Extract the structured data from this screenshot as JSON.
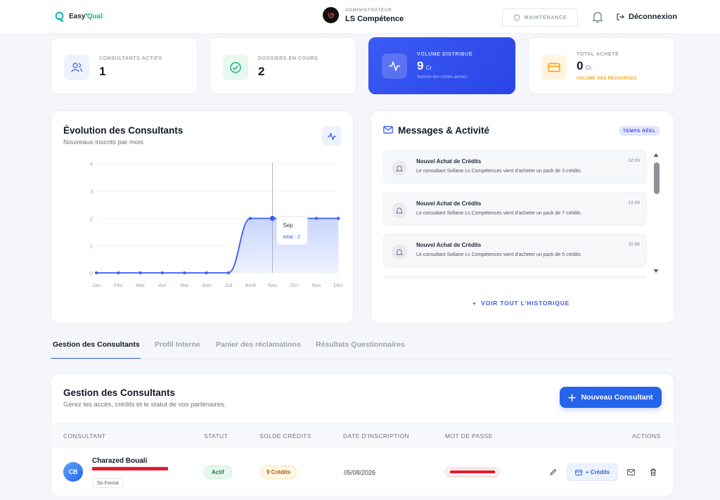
{
  "header": {
    "brand_prefix": "Easy",
    "brand_suffix": "Qual",
    "admin_role": "ADMINISTRATEUR",
    "admin_name": "LS Compétence",
    "maintenance_label": "MAINTENANCE",
    "logout_label": "Déconnexion"
  },
  "stats": [
    {
      "label": "CONSULTANTS ACTIFS",
      "value": "1",
      "unit": "",
      "sub": ""
    },
    {
      "label": "DOSSIERS EN COURS",
      "value": "2",
      "unit": "",
      "sub": ""
    },
    {
      "label": "VOLUME DISTRIBUÉ",
      "value": "9",
      "unit": "Cr.",
      "sub": "Somme des soldes actuels"
    },
    {
      "label": "TOTAL ACHETÉ",
      "value": "0",
      "unit": "Cr.",
      "sub": "VOLUME DES RECHARGES"
    }
  ],
  "chart_panel": {
    "title": "Évolution des Consultants",
    "subtitle": "Nouveaux inscrits par mois",
    "tooltip_label": "Sep",
    "tooltip_value": "total : 2"
  },
  "chart_data": {
    "type": "area",
    "categories": [
      "Jan",
      "Fév",
      "Mar",
      "Avr",
      "Mai",
      "Juin",
      "Juil",
      "Août",
      "Sep",
      "Oct",
      "Nov",
      "Déc"
    ],
    "series": [
      {
        "name": "total",
        "values": [
          0,
          0,
          0,
          0,
          0,
          0,
          0,
          2,
          2,
          2,
          2,
          2
        ]
      }
    ],
    "ylim": [
      0,
      4
    ],
    "yticks": [
      0,
      1,
      2,
      3,
      4
    ],
    "grid": true,
    "highlight_index": 8,
    "colors": {
      "line": "#3b5bf5",
      "fill": "#dfe6fd"
    }
  },
  "messages_panel": {
    "title": "Messages & Activité",
    "badge": "TEMPS RÉEL",
    "items": [
      {
        "title": "Nouvel Achat de Crédits",
        "desc": "Le consultant Sofiane Ls Compétences vient d'acheter un pack de 3 crédits.",
        "time": "12:00"
      },
      {
        "title": "Nouvel Achat de Crédits",
        "desc": "Le consultant Sofiane Ls Compétences vient d'acheter un pack de 7 crédits.",
        "time": "12:00"
      },
      {
        "title": "Nouvel Achat de Crédits",
        "desc": "Le consultant Sofiane Ls Compétences vient d'acheter un pack de 5 crédits.",
        "time": "11:56"
      }
    ],
    "see_all": "VOIR TOUT L'HISTORIQUE"
  },
  "tabs": [
    "Gestion des Consultants",
    "Profil Interne",
    "Panier des réclamations",
    "Résultats Questionnaires"
  ],
  "table_panel": {
    "title": "Gestion des Consultants",
    "subtitle": "Gérez les accès, crédits et le statut de vos partenaires.",
    "new_button": "Nouveau Consultant",
    "columns": [
      "CONSULTANT",
      "STATUT",
      "SOLDE CRÉDITS",
      "DATE D'INSCRIPTION",
      "MOT DE PASSE",
      "ACTIONS"
    ],
    "rows": [
      {
        "initials": "CB",
        "name": "Charazed Bouali",
        "chip": "So Forma",
        "status": "Actif",
        "credits": "9 Crédits",
        "date": "05/08/2026",
        "credit_action": "+ Crédits"
      }
    ]
  },
  "colors": {
    "accent": "#3b5bf5",
    "brand_green": "#10b981",
    "status_green": "#15803d",
    "credit_orange": "#b45309"
  }
}
